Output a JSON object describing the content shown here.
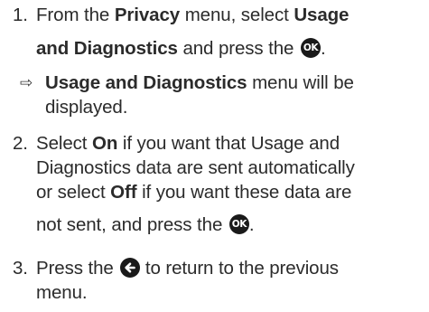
{
  "steps": [
    {
      "number": "1.",
      "line1_pre": "From the ",
      "line1_b1": "Privacy",
      "line1_mid": " menu, select ",
      "line1_b2": "Usage",
      "line2_b": "and Diagnostics",
      "line2_post": " and press the",
      "line2_end": ".",
      "result_symbol": "⇨",
      "result_b": "Usage and Diagnostics",
      "result_line1_post": " menu will be",
      "result_line2": "displayed."
    },
    {
      "number": "2.",
      "line1_pre": "Select ",
      "line1_b": "On",
      "line1_post": " if you want that Usage and",
      "line2": "Diagnostics data are sent automatically",
      "line3_pre": "or select ",
      "line3_b": "Off",
      "line3_post": " if you want these data are",
      "line4": "not sent, and press the",
      "line4_end": "."
    },
    {
      "number": "3.",
      "line1_pre": "Press the",
      "line1_post": " to return to the previous",
      "line2": "menu."
    }
  ],
  "icons": {
    "ok_label": "OK",
    "ok_icon": "ok-button-icon",
    "back_icon": "back-arrow-button-icon"
  }
}
